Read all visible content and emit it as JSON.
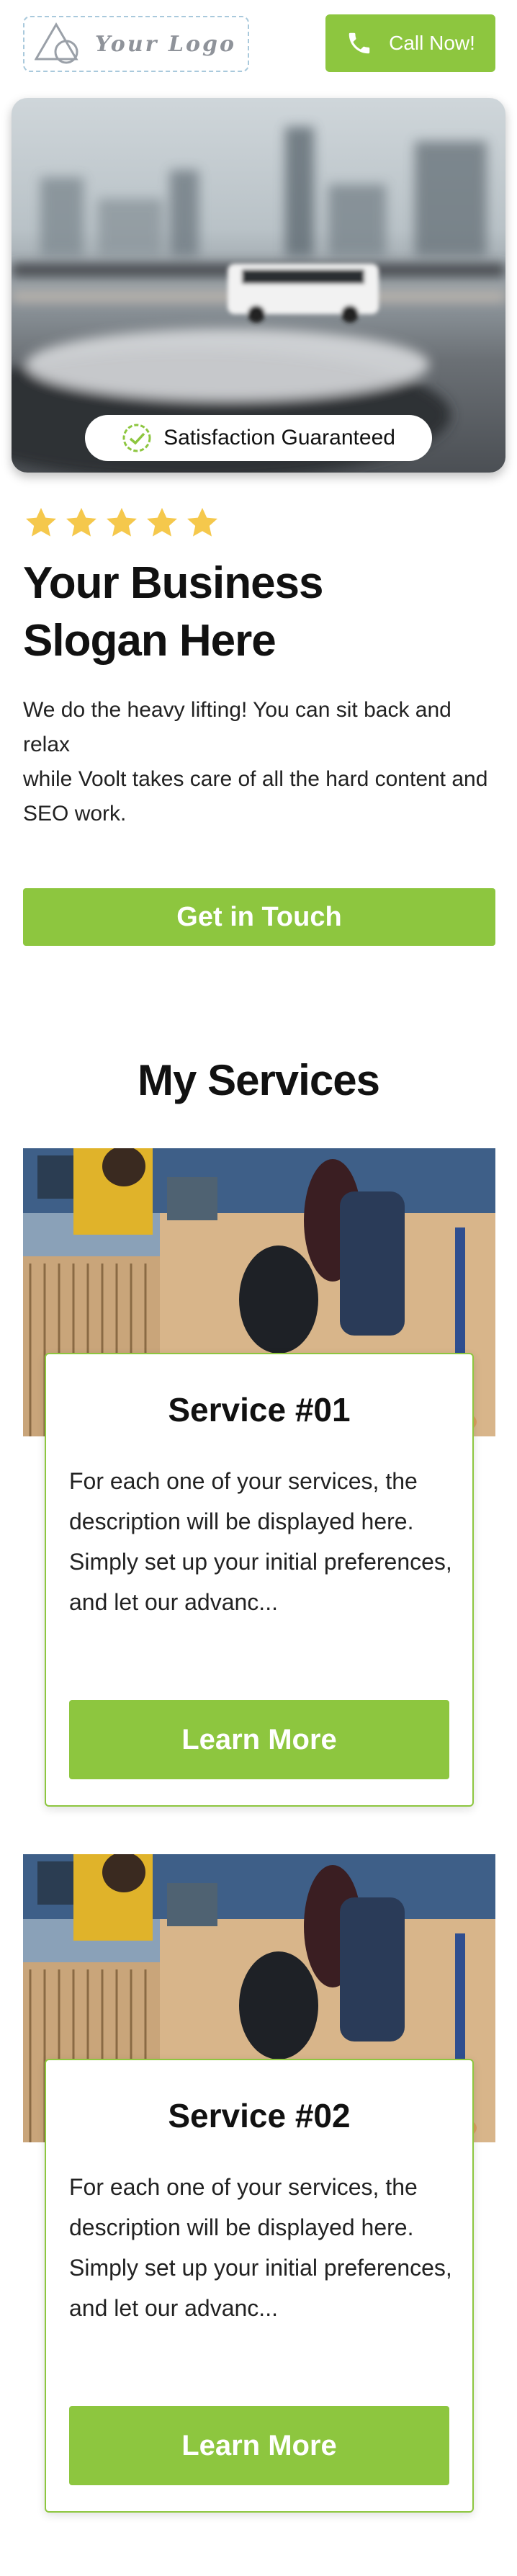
{
  "header": {
    "logo_text": "Your Logo",
    "call_label": "Call Now!"
  },
  "hero": {
    "badge_text": "Satisfaction Guaranteed"
  },
  "rating": {
    "stars": 5,
    "star_color": "#f5c84c"
  },
  "slogan": "Your Business Slogan Here",
  "lead": {
    "line1": "We do the heavy lifting! You can sit back and relax",
    "line2": "while Voolt takes care of all the hard  content and SEO work."
  },
  "cta": {
    "label": "Get in Touch"
  },
  "services": {
    "title": "My Services",
    "items": [
      {
        "title": "Service #01",
        "description": "For each one of your services, the description will be displayed here. Simply set up your initial preferences, and let our advanc...",
        "button": "Learn More"
      },
      {
        "title": "Service #02",
        "description": "For each one of your services, the description will be displayed here. Simply set up your initial preferences, and let our advanc...",
        "button": "Learn More"
      }
    ]
  },
  "colors": {
    "accent": "#8dc63f",
    "text": "#111111",
    "logo_border": "#a9c9dc"
  },
  "icons": [
    "logo-triangle-icon",
    "phone-icon",
    "check-circle-icon",
    "star-icon"
  ]
}
